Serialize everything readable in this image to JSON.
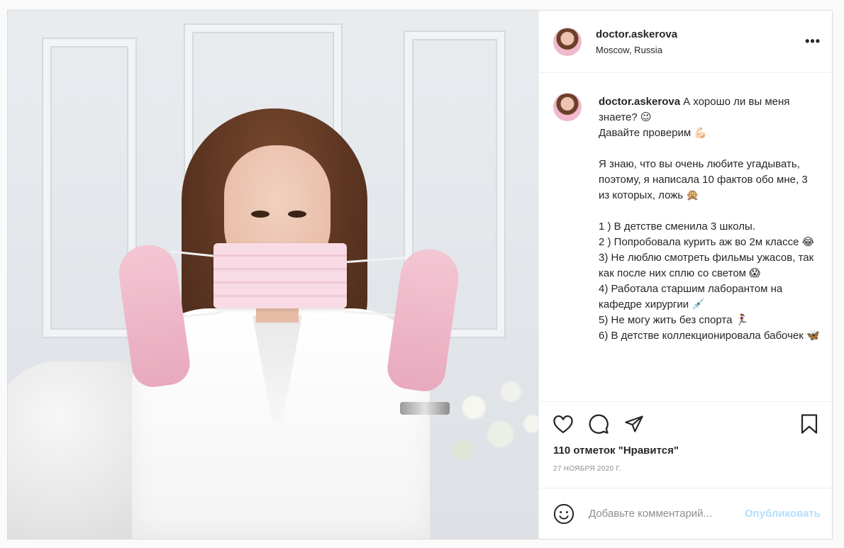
{
  "post": {
    "username": "doctor.askerova",
    "location": "Moscow, Russia",
    "more_label": "•••",
    "caption": {
      "username": "doctor.askerova",
      "lines": [
        "А хорошо ли вы меня знаете? 😉",
        "Давайте проверим 💪🏻",
        "",
        "Я знаю, что вы очень любите угадывать, поэтому, я написала 10 фактов обо мне, 3 из которых, ложь 🙊",
        "",
        "1 ) В детстве сменила 3 школы.",
        "2 ) Попробовала курить аж во 2м классе 😂",
        "3) Не люблю смотреть фильмы ужасов, так как после них сплю со светом 😱",
        "4) Работала старшим лаборантом на кафедре хирургии 💉",
        "5) Не могу жить без спорта 🏃‍♀️",
        "6) В детстве коллекционировала бабочек 🦋"
      ]
    },
    "likes": "110 отметок \"Нравится\"",
    "date": "27 НОЯБРЯ 2020 Г.",
    "comment": {
      "placeholder": "Добавьте комментарий...",
      "publish_label": "Опубликовать"
    }
  },
  "icons": {
    "like": "heart-icon",
    "comment": "comment-icon",
    "share": "share-icon",
    "save": "bookmark-icon",
    "emoji": "emoji-icon"
  },
  "colors": {
    "text": "#262626",
    "muted": "#8e8e8e",
    "border": "#dbdbdb",
    "publish_disabled": "#b2dffc"
  }
}
